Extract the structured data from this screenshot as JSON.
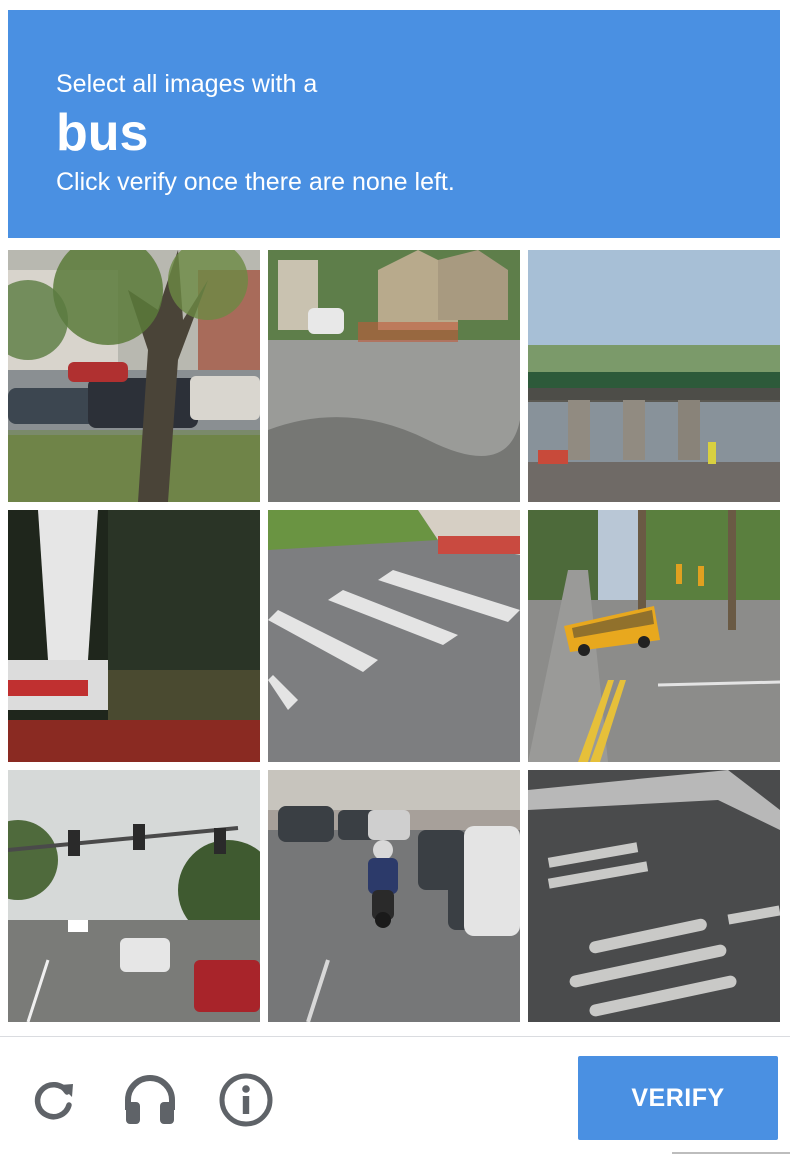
{
  "header": {
    "instruction": "Select all images with a",
    "keyword": "bus",
    "subtext": "Click verify once there are none left.",
    "background_color": "#4a90e2"
  },
  "grid": {
    "rows": 3,
    "columns": 3,
    "tiles": [
      {
        "index": 1,
        "scene": "park with tree and parked cars"
      },
      {
        "index": 2,
        "scene": "residential street intersection with houses"
      },
      {
        "index": 3,
        "scene": "highway overpass bridge"
      },
      {
        "index": 4,
        "scene": "crane truck against trees"
      },
      {
        "index": 5,
        "scene": "crosswalk stripes on asphalt"
      },
      {
        "index": 6,
        "scene": "yellow school bus at intersection"
      },
      {
        "index": 7,
        "scene": "road with traffic lights and cars"
      },
      {
        "index": 8,
        "scene": "motorcyclist on street with parked cars"
      },
      {
        "index": 9,
        "scene": "road markings on asphalt"
      }
    ]
  },
  "footer": {
    "icons": [
      "reload-icon",
      "audio-challenge-icon",
      "info-icon"
    ],
    "verify_label": "VERIFY",
    "button_color": "#4a90e2"
  }
}
